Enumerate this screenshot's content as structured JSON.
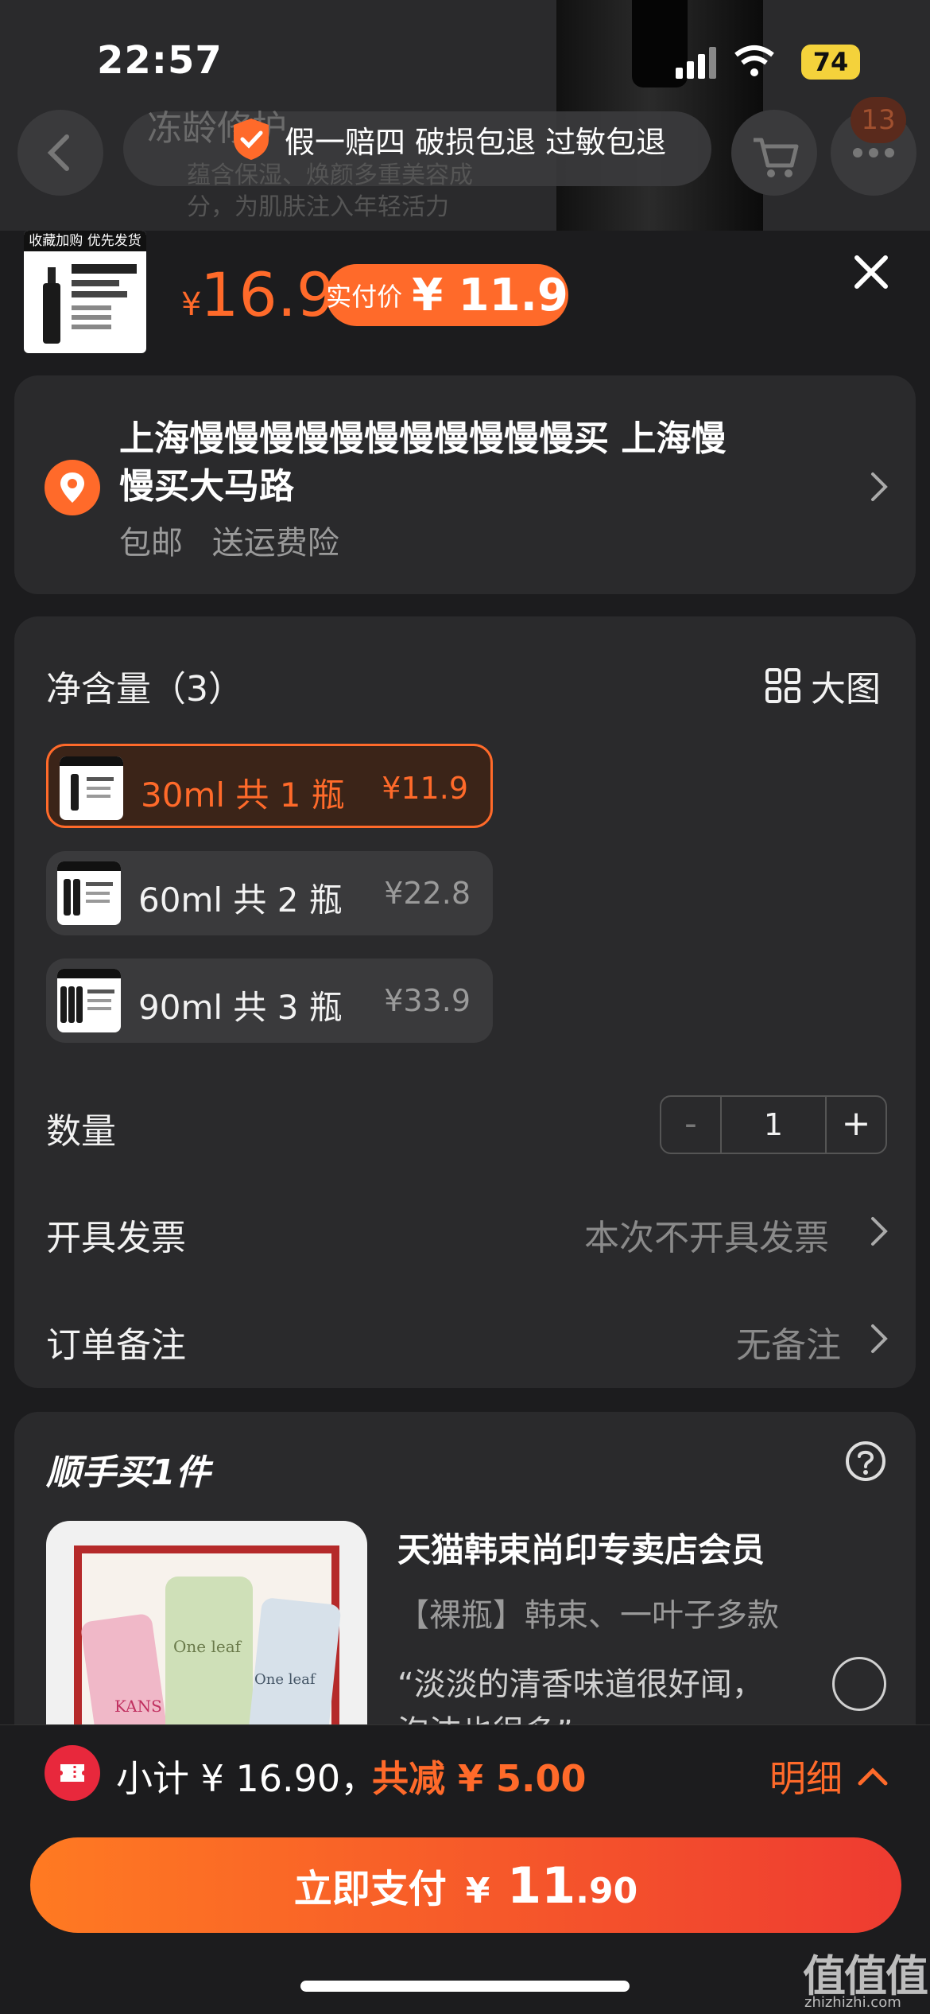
{
  "status_bar": {
    "time": "22:57",
    "battery": "74"
  },
  "background_page": {
    "title": "冻龄修护",
    "line1": "蕴含保湿、焕颜多重美容成",
    "line2": "分，为肌肤注入年轻活力",
    "cart_badge": "13"
  },
  "guarantee": {
    "text": "假一赔四 破损包退 过敏包退"
  },
  "product": {
    "thumb_banner": "收藏加购 优先发货",
    "currency": "¥",
    "price": "16.9",
    "pay_label": "实付价",
    "pay_price": "¥ 11.9"
  },
  "address": {
    "line1": "上海慢慢慢慢慢慢慢慢慢慢慢买 上海慢",
    "line2": "慢买大马路",
    "tags": "包邮 送运费险"
  },
  "options": {
    "title": "净含量（3）",
    "big_image_label": "大图",
    "skus": [
      {
        "name": "30ml 共 1 瓶",
        "price": "¥11.9",
        "selected": true
      },
      {
        "name": "60ml 共 2 瓶",
        "price": "¥22.8",
        "selected": false
      },
      {
        "name": "90ml 共 3 瓶",
        "price": "¥33.9",
        "selected": false
      }
    ],
    "quantity_label": "数量",
    "quantity_minus": "-",
    "quantity_value": "1",
    "quantity_plus": "+",
    "invoice_label": "开具发票",
    "invoice_value": "本次不开具发票",
    "remark_label": "订单备注",
    "remark_value": "无备注"
  },
  "addon": {
    "title": "顺手买1件",
    "store": "天猫韩束尚印专卖店会员",
    "desc": "【裸瓶】韩束、一叶子多款",
    "quote_line1": "“淡淡的清香味道很好闻，",
    "quote_line2": "泡沫也很多”",
    "brand1": "KANS",
    "brand2": "One leaf",
    "brand3": "One leaf"
  },
  "bottom": {
    "subtotal": "小计 ¥ 16.90，",
    "discount": "共减 ¥ 5.00",
    "detail": "明细",
    "pay_label": "立即支付",
    "pay_currency": "¥",
    "pay_int": "11",
    "pay_dec": ".90"
  },
  "watermark": {
    "main": "值值值",
    "sub": "zhizhizhi.com"
  },
  "colors": {
    "accent": "#ff6a2a",
    "background": "#1c1c1e",
    "card": "#2a2a2c",
    "coupon": "#e8283c"
  }
}
